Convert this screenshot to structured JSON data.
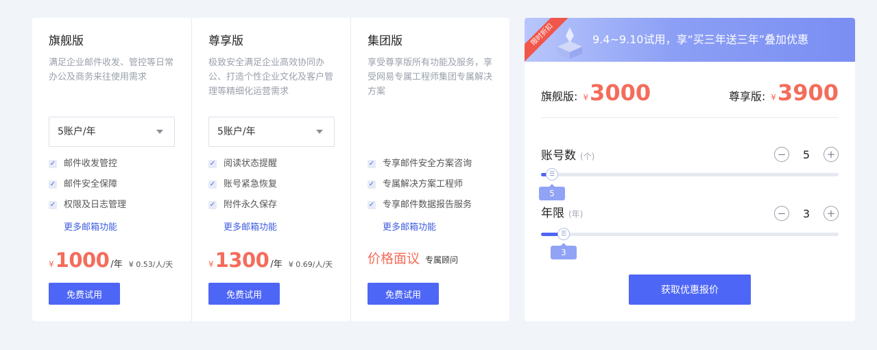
{
  "plans": [
    {
      "name": "旗舰版",
      "desc": "满足企业邮件收发、管控等日常办公及商务来往使用需求",
      "select_value": "5账户/年",
      "features": [
        "邮件收发管控",
        "邮件安全保障",
        "权限及日志管理"
      ],
      "more": "更多邮箱功能",
      "currency": "¥",
      "price": "1000",
      "unit": "/年",
      "per_user": "¥ 0.53/人/天",
      "trial": "免费试用"
    },
    {
      "name": "尊享版",
      "desc": "极致安全满足企业高效协同办公、打造个性企业文化及客户管理等精细化运营需求",
      "select_value": "5账户/年",
      "features": [
        "阅读状态提醒",
        "账号紧急恢复",
        "附件永久保存"
      ],
      "more": "更多邮箱功能",
      "currency": "¥",
      "price": "1300",
      "unit": "/年",
      "per_user": "¥ 0.69/人/天",
      "trial": "免费试用"
    },
    {
      "name": "集团版",
      "desc": "享受尊享版所有功能及服务，享受网易专属工程师集团专属解决方案",
      "features": [
        "专享邮件安全方案咨询",
        "专属解决方案工程师",
        "专享邮件数据报告服务"
      ],
      "more": "更多邮箱功能",
      "price_text": "价格面议",
      "consult": "专属顾问",
      "trial": "免费试用"
    }
  ],
  "calculator": {
    "ribbon": "限时折扣",
    "banner_text": "9.4~9.10试用，享“买三年送三年”叠加优惠",
    "summary": [
      {
        "label": "旗舰版:",
        "currency": "¥",
        "value": "3000"
      },
      {
        "label": "尊享版:",
        "currency": "¥",
        "value": "3900"
      }
    ],
    "accounts": {
      "label": "账号数",
      "unit": "(个)",
      "value": "5",
      "slider_fraction": 0.01
    },
    "years": {
      "label": "年限",
      "unit": "(年)",
      "value": "3",
      "slider_fraction": 0.05
    },
    "thumb_glyph": "☰",
    "minus": "−",
    "plus": "+",
    "quote_button": "获取优惠报价"
  },
  "colors": {
    "accent": "#4e66f5",
    "price": "#f46c5b"
  },
  "icons": {
    "checkbox": "check-icon",
    "caret": "caret-down-icon",
    "ribbon": "ribbon-badge"
  }
}
